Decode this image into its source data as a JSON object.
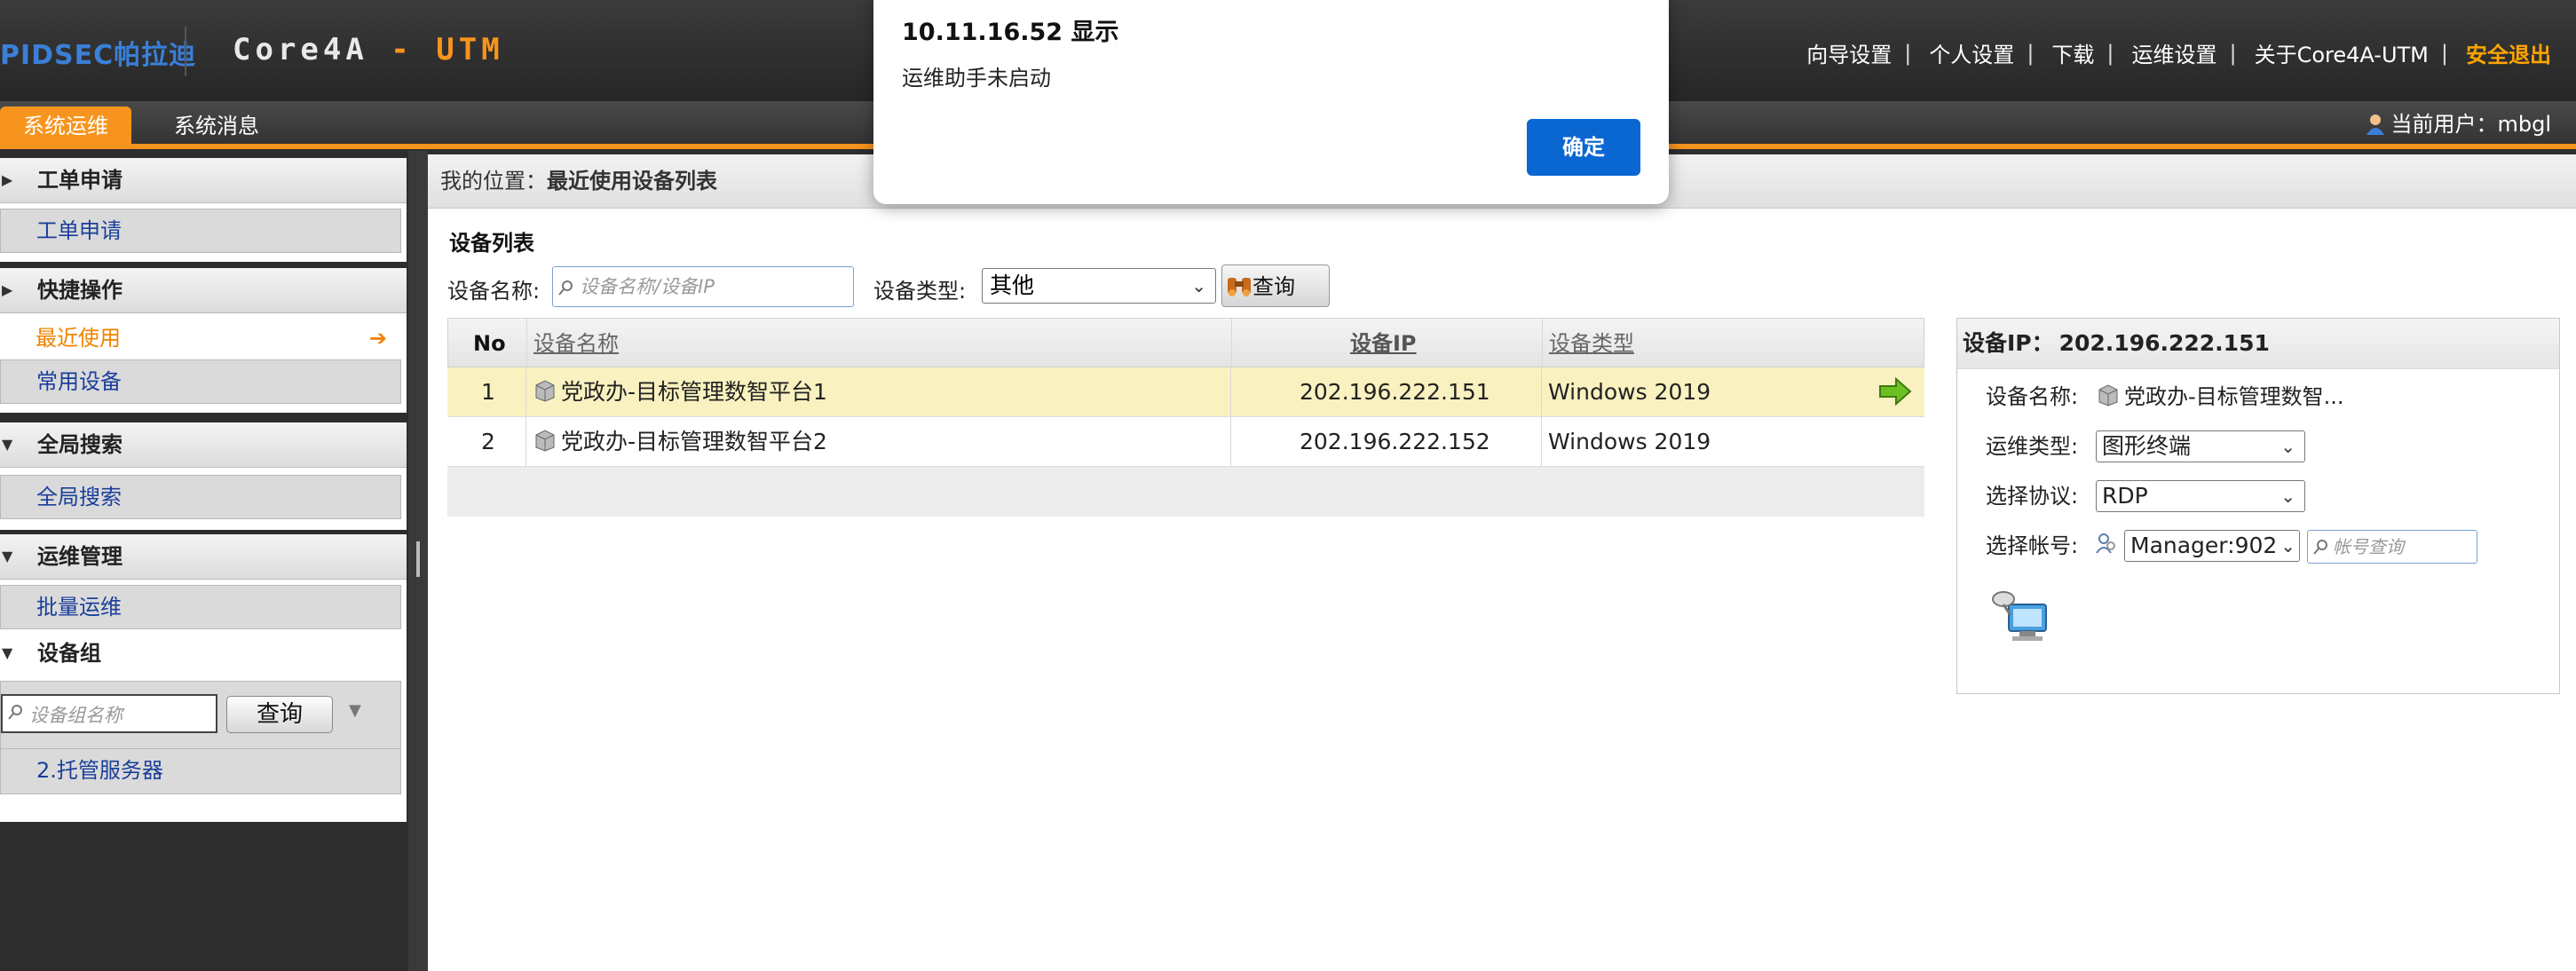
{
  "header": {
    "logo_text": "PIDSEC帕拉迪",
    "product_prefix": "Core4A",
    "product_dash": " - ",
    "product_suffix": "UTM",
    "links": [
      "向导设置",
      "个人设置",
      "下载",
      "运维设置",
      "关于Core4A-UTM"
    ],
    "separator": "|",
    "logout": "安全退出"
  },
  "tabs": {
    "active": "系统运维",
    "other": "系统消息"
  },
  "current_user": "当前用户：mbgl",
  "sidebar": {
    "sections": [
      {
        "title": "工单申请",
        "items": [
          "工单申请"
        ]
      },
      {
        "title": "快捷操作",
        "items": [
          "最近使用",
          "常用设备"
        ],
        "active_item": "最近使用"
      },
      {
        "title": "全局搜索",
        "items": [
          "全局搜索"
        ]
      },
      {
        "title": "运维管理",
        "items": [
          "批量运维"
        ]
      },
      {
        "title": "设备组",
        "search_placeholder": "设备组名称",
        "search_button": "查询",
        "items": [
          "2.托管服务器"
        ]
      }
    ],
    "active_arrow": "➔"
  },
  "breadcrumb": {
    "label": "我的位置：",
    "value": "最近使用设备列表"
  },
  "device_list": {
    "heading": "设备列表",
    "name_label": "设备名称:",
    "name_placeholder": "设备名称/设备IP",
    "type_label": "设备类型:",
    "type_value": "其他",
    "query_button": "查询",
    "columns": [
      "No",
      "设备名称",
      "设备IP",
      "设备类型"
    ],
    "rows": [
      {
        "no": "1",
        "name": "党政办-目标管理数智平台1",
        "ip": "202.196.222.151",
        "type": "Windows 2019",
        "selected": true
      },
      {
        "no": "2",
        "name": "党政办-目标管理数智平台2",
        "ip": "202.196.222.152",
        "type": "Windows 2019",
        "selected": false
      }
    ]
  },
  "detail": {
    "title_label": "设备IP：",
    "title_ip": "202.196.222.151",
    "name_label": "设备名称:",
    "name_value": "党政办-目标管理数智...",
    "ops_type_label": "运维类型:",
    "ops_type_value": "图形终端",
    "protocol_label": "选择协议:",
    "protocol_value": "RDP",
    "account_label": "选择帐号:",
    "account_value": "Manager:902",
    "account_search_placeholder": "帐号查询"
  },
  "dialog": {
    "title": "10.11.16.52 显示",
    "message": "运维助手未启动",
    "ok": "确定"
  },
  "colors": {
    "accent": "#f7941d",
    "link": "#1a3f9a",
    "dialog_button": "#0a67d1",
    "selected_row": "#f9f2c0"
  }
}
